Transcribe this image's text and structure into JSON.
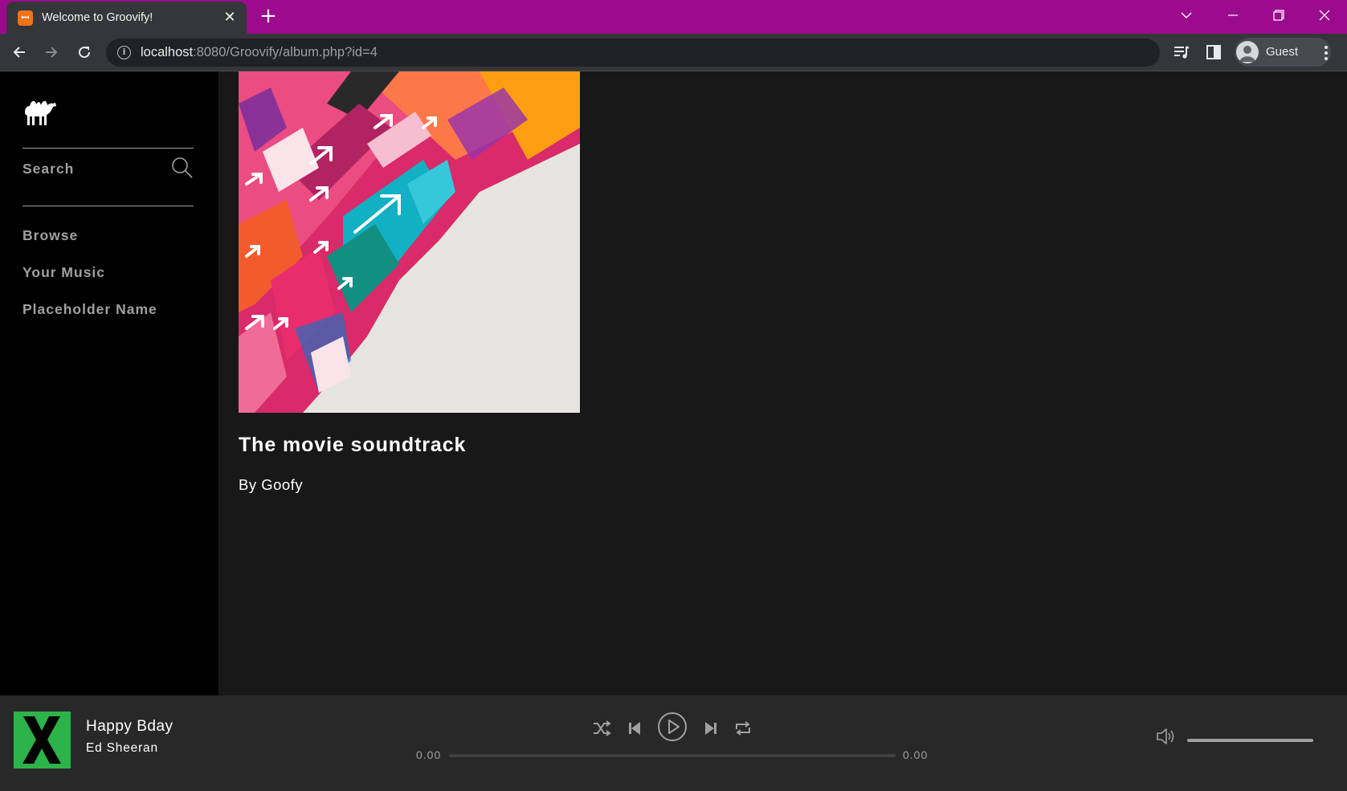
{
  "browser": {
    "tab_title": "Welcome to Groovify!",
    "tab_favicon": "xampp-icon",
    "url_host": "localhost",
    "url_rest": ":8080/Groovify/album.php?id=4",
    "profile_label": "Guest"
  },
  "sidebar": {
    "search_label": "Search",
    "nav": [
      {
        "label": "Browse"
      },
      {
        "label": "Your Music"
      },
      {
        "label": "Placeholder Name"
      }
    ]
  },
  "album": {
    "title": "The movie soundtrack",
    "artist": "By Goofy"
  },
  "player": {
    "track_title": "Happy Bday",
    "track_artist": "Ed Sheeran",
    "current_time": "0.00",
    "total_time": "0.00",
    "progress": 0,
    "volume": 1.0
  },
  "colors": {
    "tab_strip": "#9c0b8e",
    "sidebar_bg": "#000000",
    "main_bg": "#181818",
    "player_bg": "#282828",
    "now_playing_art": "#2cb34a"
  }
}
